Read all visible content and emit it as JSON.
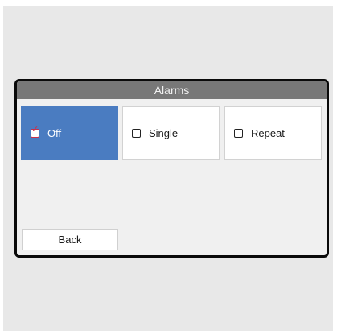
{
  "window": {
    "title": "Alarms"
  },
  "options": [
    {
      "label": "Off",
      "checked": true
    },
    {
      "label": "Single",
      "checked": false
    },
    {
      "label": "Repeat",
      "checked": false
    }
  ],
  "footer": {
    "back_label": "Back"
  },
  "colors": {
    "titlebar": "#787878",
    "selected": "#4a7cc1",
    "check_accent": "#c8314b",
    "frame": "#0a0a0a",
    "background": "#e8e8e8"
  },
  "icons": {
    "checked": "checkbox-checked-icon",
    "unchecked": "checkbox-icon"
  }
}
